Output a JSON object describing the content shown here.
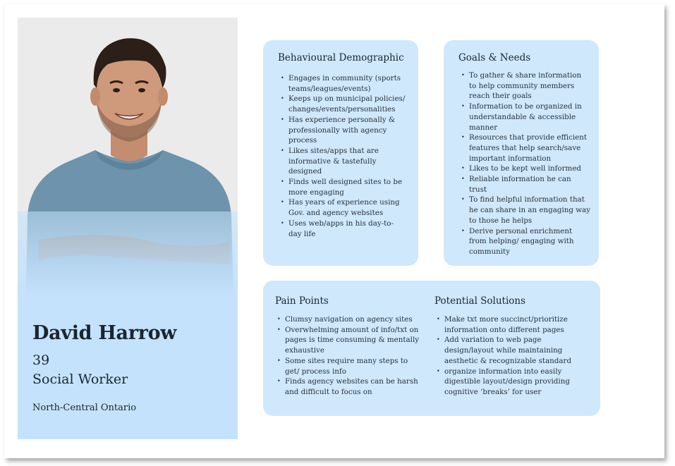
{
  "persona": {
    "name": "David Harrow",
    "age": "39",
    "role": "Social Worker",
    "location": "North-Central Ontario"
  },
  "behaviour": {
    "title": "Behavioural Demographic",
    "items": [
      "Engages in community (sports teams/leagues/events)",
      "Keeps up on municipal policies/ changes/events/personalities",
      "Has experience personally & professionally with agency process",
      "Likes sites/apps that are informative & tastefully designed",
      "Finds well designed sites to be more engaging",
      "Has years of experience using Gov. and agency websites",
      "Uses web/apps in his day-to-day life"
    ]
  },
  "goals": {
    "title": "Goals & Needs",
    "items": [
      "To gather & share information to help community members reach their goals",
      "Information to be organized in understandable & accessible manner",
      "Resources that provide efficient features that help search/save important information",
      "Likes to be kept well informed",
      "Reliable information he can trust",
      "To find helpful information that he can share in an engaging way to those he helps",
      "Derive personal enrichment from helping/ engaging with community"
    ]
  },
  "pain_points": {
    "title": "Pain Points",
    "items": [
      "Clumsy navigation on agency sites",
      "Overwhelming amount of info/txt on pages is time consuming & mentally exhaustive",
      "Some sites require many steps to get/ process info",
      "Finds agency websites can be harsh and difficult to focus on"
    ]
  },
  "solutions": {
    "title": "Potential Solutions",
    "items": [
      "Make txt more succinct/prioritize information onto different pages",
      "Add variation to web page design/layout while maintaining aesthetic & recognizable standard",
      "organize information into easily digestible layout/design providing cognitive ‘breaks’ for user"
    ]
  },
  "colors": {
    "card": "#cfe8fc",
    "profile": "#c4e2fb"
  }
}
